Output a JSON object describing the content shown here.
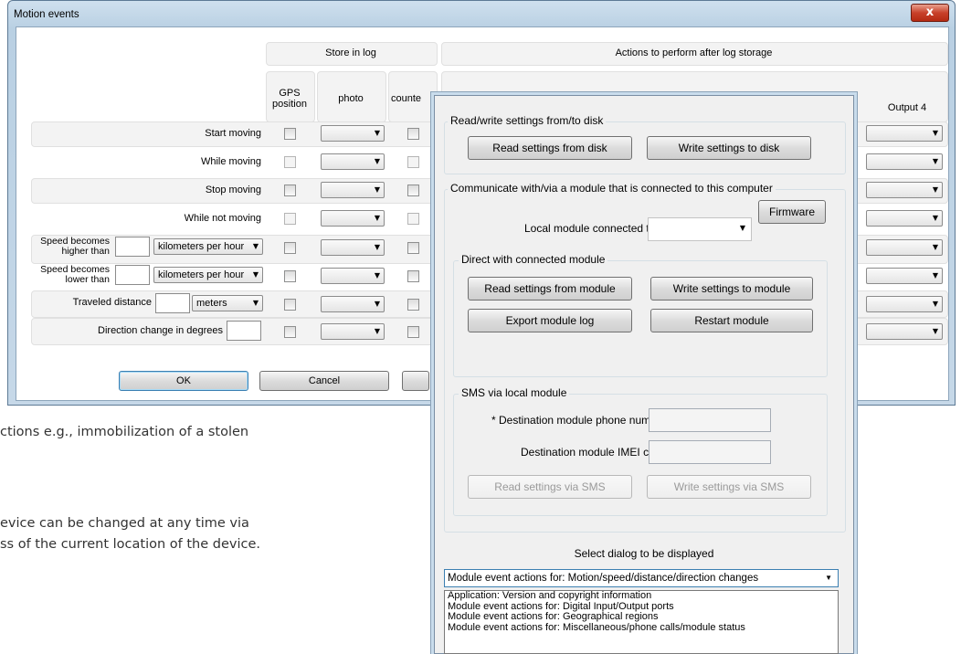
{
  "background_text": {
    "line1": "ctions e.g., immobilization of a stolen",
    "line2": "evice can be changed at any time via",
    "line3": "ss of the current location of the device."
  },
  "motion_window": {
    "title": "Motion events",
    "close_label": "x",
    "headers": {
      "store_in_log": "Store in log",
      "actions_after": "Actions to perform after log storage",
      "gps": "GPS position",
      "photo": "photo",
      "counter": "counte",
      "output4": "Output 4"
    },
    "rows": {
      "start_moving": "Start moving",
      "while_moving": "While moving",
      "stop_moving": "Stop moving",
      "while_not_moving": "While not moving",
      "speed_higher": "Speed becomes higher than",
      "speed_lower": "Speed becomes lower than",
      "traveled": "Traveled distance",
      "direction": "Direction change in degrees"
    },
    "unit_kmh": "kilometers per hour",
    "unit_meters": "meters",
    "ok": "OK",
    "cancel": "Cancel"
  },
  "settings_dialog": {
    "disk_group": "Read/write settings from/to disk",
    "read_disk": "Read settings from disk",
    "write_disk": "Write settings to disk",
    "comm_group": "Communicate with/via a module that is connected to this computer",
    "firmware": "Firmware",
    "local_module_label": "Local module connected to",
    "direct_group": "Direct with connected module",
    "read_module": "Read settings from module",
    "write_module": "Write settings to module",
    "export_log": "Export module log",
    "restart": "Restart module",
    "sms_group": "SMS via local module",
    "dest_phone": "* Destination module phone number",
    "dest_imei": "Destination module IMEI code",
    "read_sms": "Read settings via SMS",
    "write_sms": "Write settings via SMS",
    "select_dialog_label": "Select dialog to be displayed",
    "selected": "Module event actions for: Motion/speed/distance/direction changes",
    "options": [
      "Application: Version and copyright information",
      "Module event actions for: Digital Input/Output ports",
      "Module event actions for: Geographical regions",
      "Module event actions for: Miscellaneous/phone calls/module status"
    ]
  },
  "colors": {
    "titlebar": "#b9d0e3",
    "close_button": "#c8412a",
    "band": "#f3f3f3",
    "dialog": "#f0f0f0",
    "focus": "#3c7fb1"
  }
}
